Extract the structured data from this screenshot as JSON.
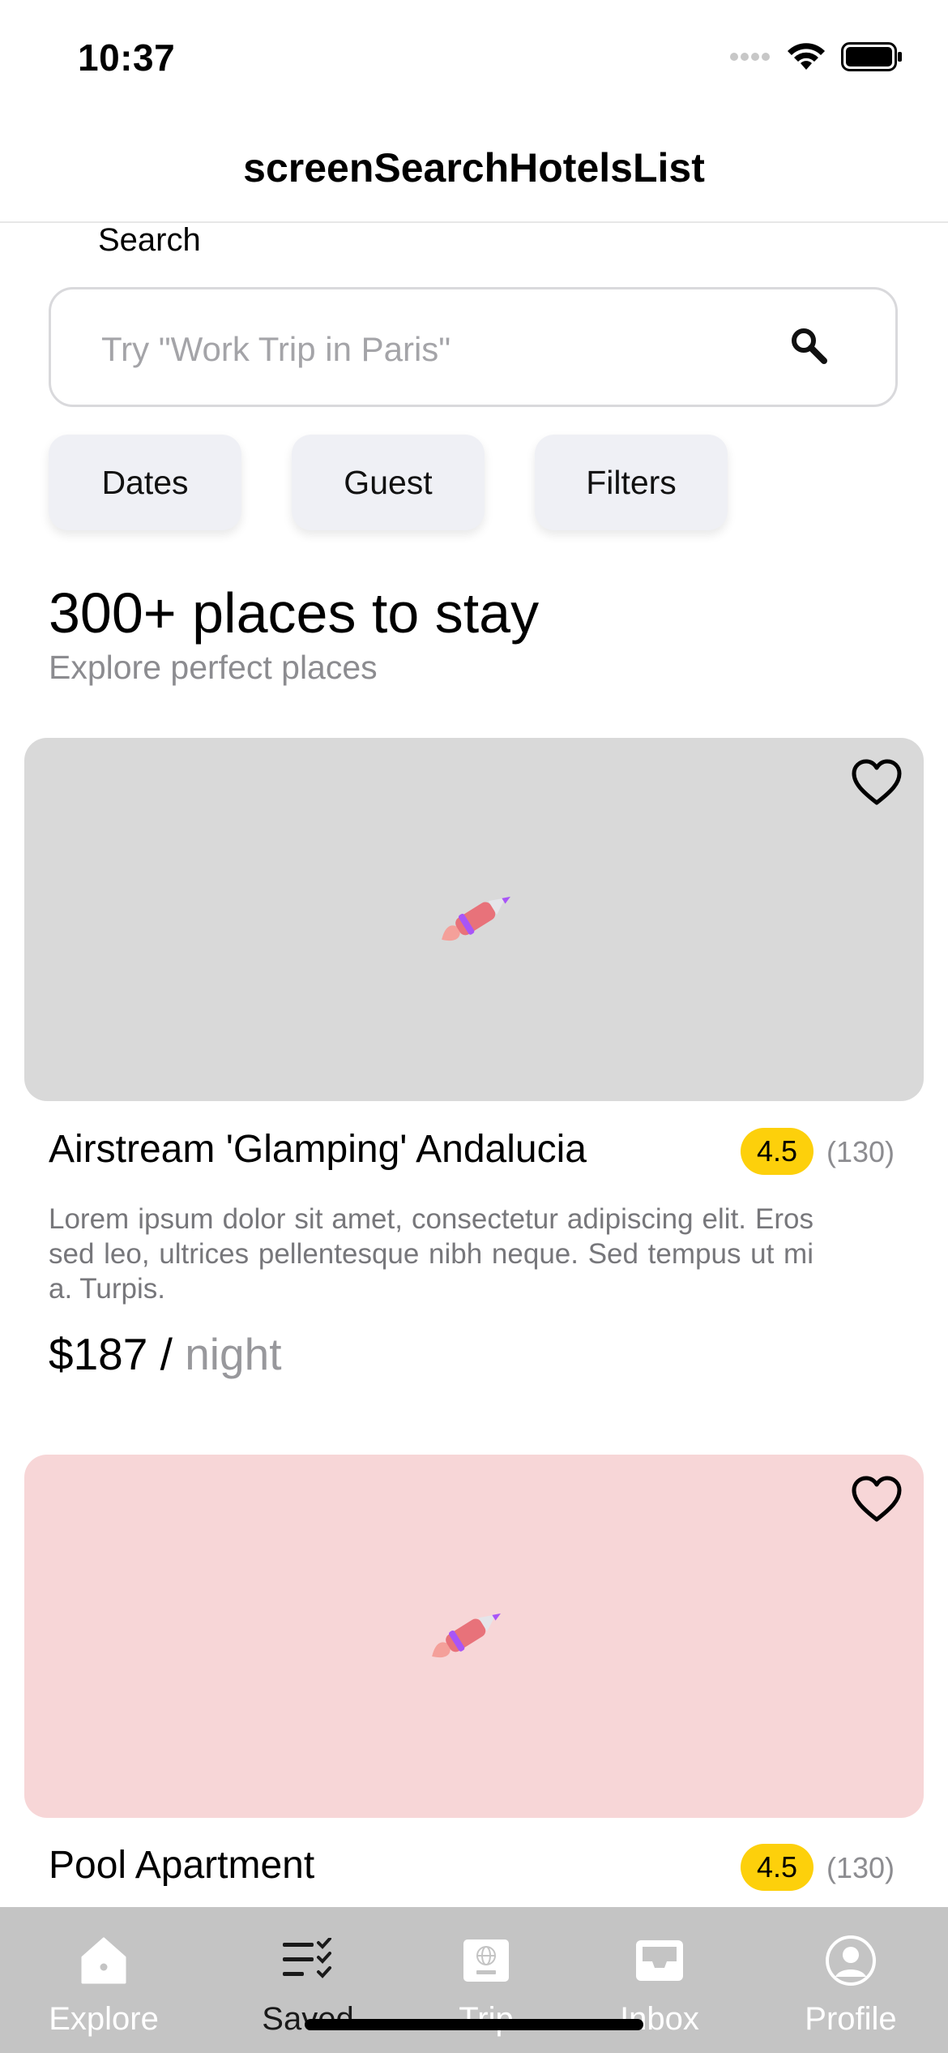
{
  "status_bar": {
    "time": "10:37"
  },
  "nav": {
    "title": "screenSearchHotelsList"
  },
  "search": {
    "label": "Search",
    "placeholder": "Try \"Work Trip in Paris\"",
    "value": ""
  },
  "chips": [
    {
      "label": "Dates"
    },
    {
      "label": "Guest"
    },
    {
      "label": "Filters"
    }
  ],
  "section": {
    "title": "300+ places to stay",
    "subtitle": "Explore perfect places"
  },
  "listings": [
    {
      "title": "Airstream 'Glamping' Andalucia",
      "rating": "4.5",
      "reviews": "(130)",
      "description": "Lorem ipsum dolor sit amet, consectetur adipiscing elit. Eros sed leo, ultrices pellentesque nibh neque. Sed tempus ut mi a. Turpis.",
      "price": "$187 /",
      "price_unit": "night",
      "image_color": "#d9d9d9"
    },
    {
      "title": "Pool Apartment",
      "rating": "4.5",
      "reviews": "(130)",
      "image_color": "#f7d6d7"
    }
  ],
  "tabs": [
    {
      "label": "Explore",
      "icon": "home-icon",
      "active": false
    },
    {
      "label": "Saved",
      "icon": "checklist-icon",
      "active": true
    },
    {
      "label": "Trip",
      "icon": "pass-icon",
      "active": false
    },
    {
      "label": "Inbox",
      "icon": "inbox-icon",
      "active": false
    },
    {
      "label": "Profile",
      "icon": "profile-icon",
      "active": false
    }
  ],
  "colors": {
    "rating_badge": "#fdd00b",
    "tab_bar": "#c4c4c4",
    "chip_background": "#eff0f5"
  }
}
